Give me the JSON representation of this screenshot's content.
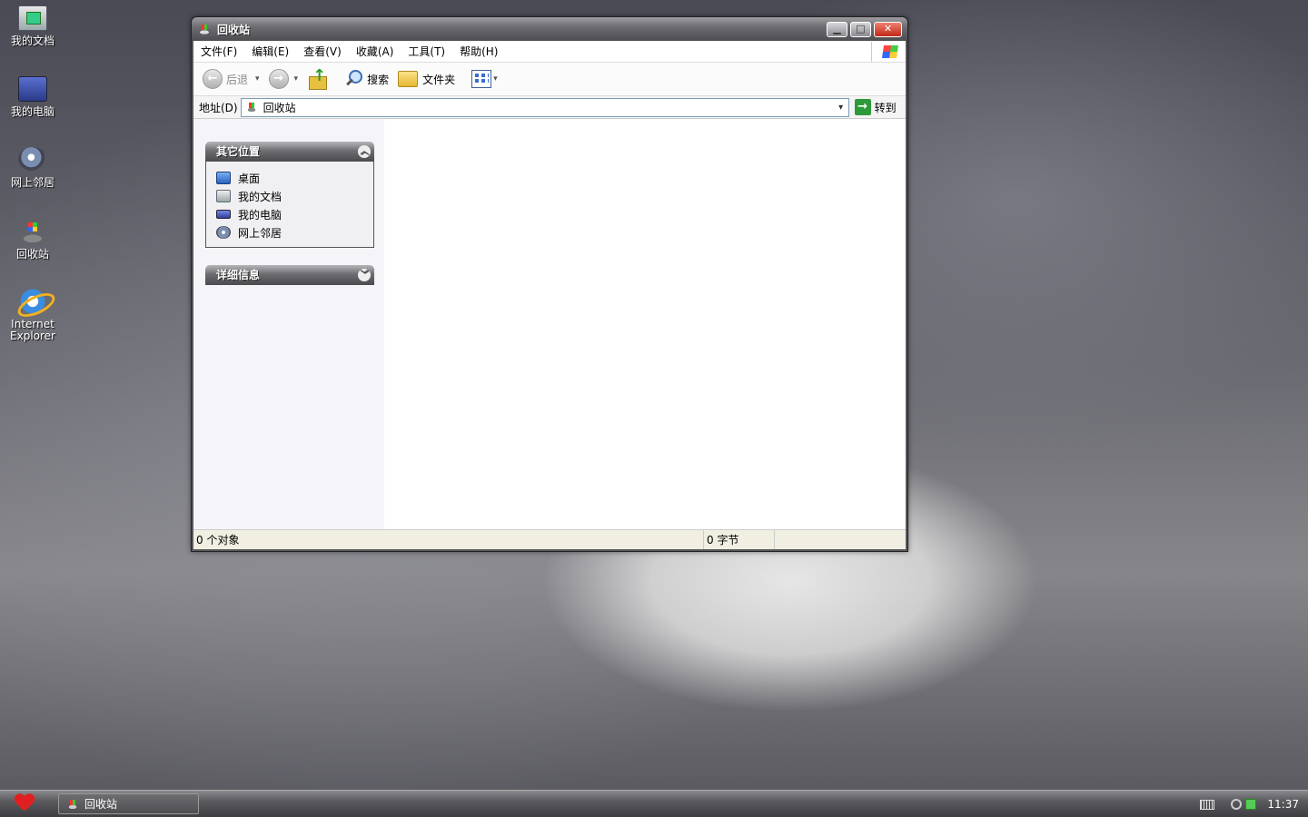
{
  "desktop": {
    "icons": [
      {
        "label": "我的文档",
        "icon": "my-documents-icon"
      },
      {
        "label": "我的电脑",
        "icon": "my-computer-icon"
      },
      {
        "label": "网上邻居",
        "icon": "network-places-icon"
      },
      {
        "label": "回收站",
        "icon": "recycle-bin-icon"
      },
      {
        "label": "Internet Explorer",
        "icon": "internet-explorer-icon"
      }
    ]
  },
  "window": {
    "title": "回收站",
    "controls": {
      "minimize": "▁",
      "maximize": "□",
      "close": "✕"
    },
    "menu": [
      "文件(F)",
      "编辑(E)",
      "查看(V)",
      "收藏(A)",
      "工具(T)",
      "帮助(H)"
    ],
    "toolbar": {
      "back": "后退",
      "search": "搜索",
      "folders": "文件夹",
      "back_glyph": "←",
      "forward_glyph": "→",
      "dropdown_glyph": "▾"
    },
    "address": {
      "label": "地址(D)",
      "value": "回收站",
      "go": "转到",
      "go_glyph": "→",
      "dropdown_glyph": "▾"
    },
    "taskpane": {
      "other_places": {
        "title": "其它位置",
        "chevron": "︿",
        "links": [
          "桌面",
          "我的文档",
          "我的电脑",
          "网上邻居"
        ]
      },
      "details": {
        "title": "详细信息",
        "chevron": "﹀"
      }
    },
    "status": {
      "objects": "0 个对象",
      "size": "0 字节"
    }
  },
  "taskbar": {
    "task_label": "回收站",
    "clock": "11:37"
  },
  "colors": {
    "titlebar": "#6d6d72",
    "accent_go": "#2d9a3a",
    "close_button": "#c02818"
  }
}
